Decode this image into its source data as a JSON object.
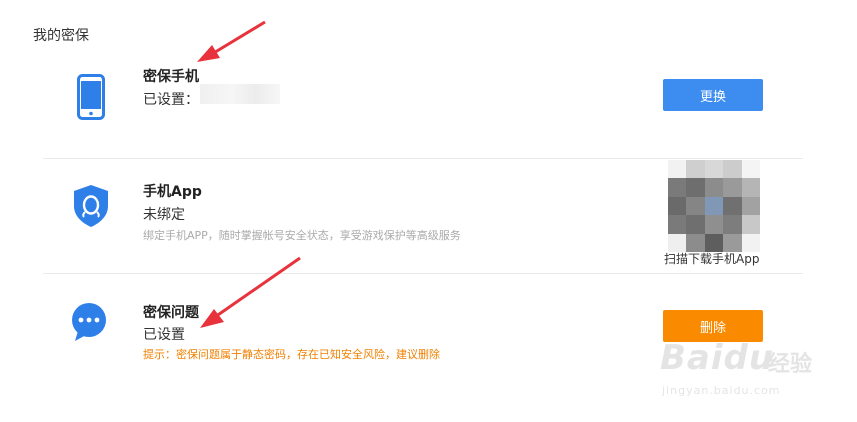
{
  "page": {
    "title": "我的密保"
  },
  "rows": [
    {
      "title": "密保手机",
      "status": "已设置：",
      "button": "更换"
    },
    {
      "title": "手机App",
      "status": "未绑定",
      "desc": "绑定手机APP，随时掌握帐号安全状态，享受游戏保护等高级服务",
      "qr_caption": "扫描下载手机App"
    },
    {
      "title": "密保问题",
      "status": "已设置",
      "warning": "提示：密保问题属于静态密码，存在已知安全风险，建议删除",
      "button": "删除"
    }
  ],
  "watermark": {
    "brand": "Baidu",
    "brand_cn": "经验",
    "url": "jingyan.baidu.com"
  },
  "colors": {
    "primary": "#3d8cf0",
    "danger": "#fa8a00",
    "warning_text": "#f08000",
    "arrow": "#e8323c"
  },
  "icons": [
    "phone-icon",
    "shield-qq-icon",
    "chat-bubble-icon"
  ]
}
